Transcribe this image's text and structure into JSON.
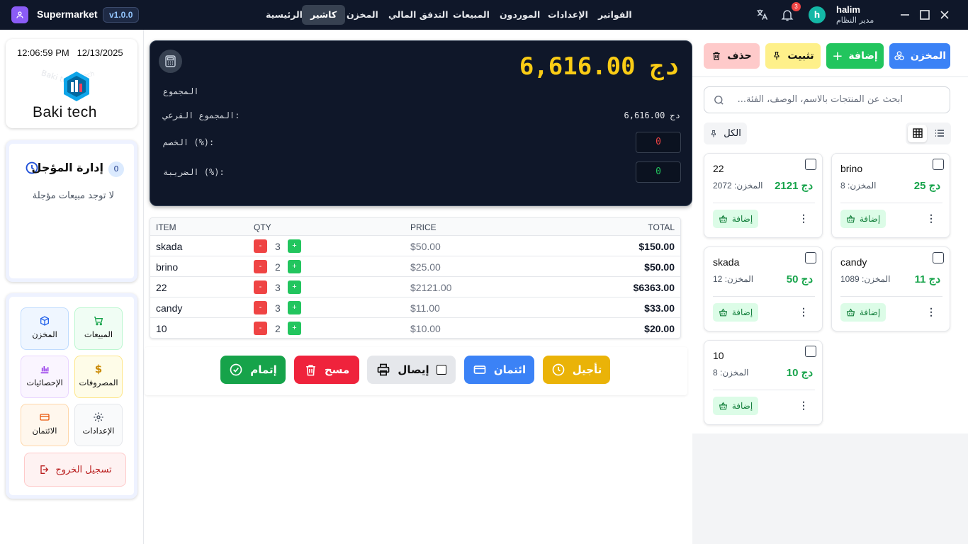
{
  "app": {
    "name": "Supermarket",
    "version": "v1.0.0"
  },
  "topnav": [
    "الرئيسية",
    "كاشير",
    "المخزن",
    "التدفق المالي",
    "المبيعات",
    "الموردون",
    "الإعدادات",
    "الفواتير"
  ],
  "active_tab": "كاشير",
  "notifications": {
    "count": "3"
  },
  "user": {
    "initial": "h",
    "name": "halim",
    "role": "مدير النظام"
  },
  "clock": {
    "time": "12:06:59 PM",
    "date": "12/13/2025"
  },
  "logo": {
    "text": "Baki tech"
  },
  "deferred": {
    "title": "إدارة المؤجل",
    "count": "0",
    "empty": "لا توجد مبيعات مؤجلة"
  },
  "sidebar": {
    "sales": "المبيعات",
    "store": "المخزن",
    "expenses": "المصروفات",
    "stats": "الإحصائيات",
    "settings": "الإعدادات",
    "credit": "الائتمان",
    "logout": "تسجيل الخروج"
  },
  "totals": {
    "grand": "دج 6,616.00",
    "total_label": "المجموع",
    "subtotal_label": "المجموع الفرعي:",
    "subtotal_value": "دج 6,616.00",
    "discount_label": "الخصم (%):",
    "discount_value": "0",
    "tax_label": "الضريبة (%):",
    "tax_value": "0"
  },
  "table": {
    "headers": {
      "item": "ITEM",
      "qty": "QTY",
      "price": "PRICE",
      "total": "TOTAL"
    },
    "rows": [
      {
        "item": "skada",
        "qty": "3",
        "price": "$50.00",
        "total": "$150.00"
      },
      {
        "item": "brino",
        "qty": "2",
        "price": "$25.00",
        "total": "$50.00"
      },
      {
        "item": "22",
        "qty": "3",
        "price": "$2121.00",
        "total": "$6363.00"
      },
      {
        "item": "candy",
        "qty": "3",
        "price": "$11.00",
        "total": "$33.00"
      },
      {
        "item": "10",
        "qty": "2",
        "price": "$10.00",
        "total": "$20.00"
      }
    ],
    "minus": "-",
    "plus": "+"
  },
  "actions": {
    "complete": "إتمام",
    "clear": "مسح",
    "receipt": "إيصال",
    "credit": "ائتمان",
    "defer": "تأجيل"
  },
  "products_panel": {
    "store_btn": "المخزن",
    "add_btn": "إضافة",
    "pin_btn": "تثبيت",
    "delete_btn": "حذف",
    "search_placeholder": "ابحث عن المنتجات بالاسم، الوصف، الفئة...",
    "filter_label": "الكل",
    "stock_label": "المخزن:",
    "add_label": "إضافة",
    "products": [
      {
        "name": "brino",
        "price": "دج 25",
        "stock": "8"
      },
      {
        "name": "22",
        "price": "دج 2121",
        "stock": "2072"
      },
      {
        "name": "candy",
        "price": "دج 11",
        "stock": "1089"
      },
      {
        "name": "skada",
        "price": "دج 50",
        "stock": "12"
      },
      {
        "name": "10",
        "price": "دج 10",
        "stock": "8"
      }
    ]
  },
  "colors": {
    "accent_blue": "#3b82f6",
    "success": "#22c55e",
    "danger": "#ef4444",
    "warning": "#eab308",
    "dark": "#0f1729",
    "total_yellow": "#facc15"
  }
}
